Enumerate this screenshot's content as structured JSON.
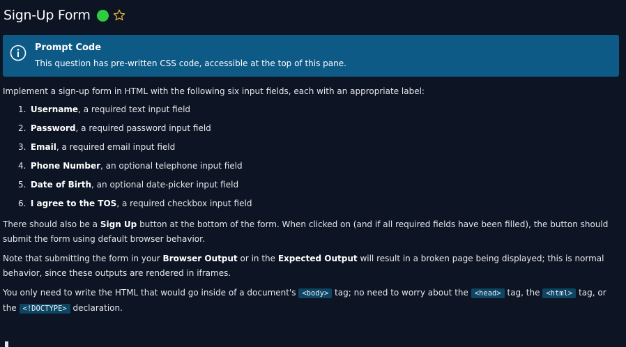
{
  "header": {
    "title": "Sign-Up Form",
    "status_icon": "green-circle",
    "favorite_icon": "star-outline"
  },
  "banner": {
    "title": "Prompt Code",
    "description": "This question has pre-written CSS code, accessible at the top of this pane."
  },
  "intro": "Implement a sign-up form in HTML with the following six input fields, each with an appropriate label:",
  "fields": [
    {
      "num": "1.",
      "name": "Username",
      "desc": ", a required text input field"
    },
    {
      "num": "2.",
      "name": "Password",
      "desc": ", a required password input field"
    },
    {
      "num": "3.",
      "name": "Email",
      "desc": ", a required email input field"
    },
    {
      "num": "4.",
      "name": "Phone Number",
      "desc": ", an optional telephone input field"
    },
    {
      "num": "5.",
      "name": "Date of Birth",
      "desc": ", an optional date-picker input field"
    },
    {
      "num": "6.",
      "name": "I agree to the TOS",
      "desc": ", a required checkbox input field"
    }
  ],
  "para1": {
    "before": "There should also be a ",
    "bold": "Sign Up",
    "after": " button at the bottom of the form. When clicked on (and if all required fields have been filled), the button should submit the form using default browser behavior."
  },
  "para2": {
    "t1": "Note that submitting the form in your ",
    "b1": "Browser Output",
    "t2": " or in the ",
    "b2": "Expected Output",
    "t3": " will result in a broken page being displayed; this is normal behavior, since these outputs are rendered in iframes."
  },
  "para3": {
    "t1": "You only need to write the HTML that would go inside of a document's ",
    "c1": "<body>",
    "t2": " tag; no need to worry about the ",
    "c2": "<head>",
    "t3": " tag, the ",
    "c3": "<html>",
    "t4": " tag, or the ",
    "c4": "<!DOCTYPE>",
    "t5": " declaration."
  },
  "colors": {
    "background": "#0d1423",
    "banner": "#0e5a86",
    "status_green": "#2ecc40",
    "star_gold": "#e2b33a",
    "code_bg": "#0e4563"
  }
}
